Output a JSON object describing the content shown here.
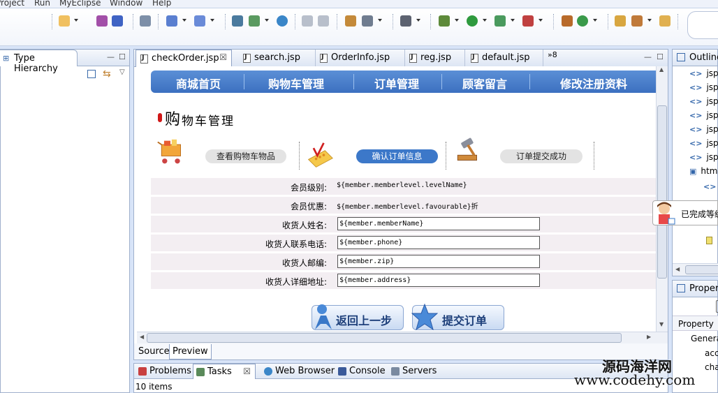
{
  "menu": [
    "Project",
    "Run",
    "MyEclipse",
    "Window",
    "Help"
  ],
  "left_view": {
    "title": "Type Hierarchy"
  },
  "editor": {
    "tabs": [
      {
        "label": "checkOrder.jsp",
        "active": true
      },
      {
        "label": "search.jsp"
      },
      {
        "label": "OrderInfo.jsp"
      },
      {
        "label": "reg.jsp"
      },
      {
        "label": "default.jsp"
      }
    ],
    "overflow_count": "»8",
    "mode_tabs": [
      "Source",
      "Preview"
    ]
  },
  "page": {
    "nav": [
      "商城首页",
      "购物车管理",
      "订单管理",
      "顾客留言",
      "修改注册资料"
    ],
    "section_title_big": "购",
    "section_title_rest": "物车管理",
    "steps": [
      {
        "label": "查看购物车物品",
        "active": false,
        "icon": "shopping-cart-icon"
      },
      {
        "label": "确认订单信息",
        "active": true,
        "icon": "calculator-icon"
      },
      {
        "label": "订单提交成功",
        "active": false,
        "icon": "gavel-icon"
      }
    ],
    "fields": [
      {
        "label": "会员级别:",
        "value": "${member.memberlevel.levelName}",
        "type": "text"
      },
      {
        "label": "会员优惠:",
        "value": "${member.memberlevel.favourable}折",
        "type": "text"
      },
      {
        "label": "收货人姓名:",
        "value": "${member.memberName}",
        "type": "input"
      },
      {
        "label": "收货人联系电话:",
        "value": "${member.phone}",
        "type": "input"
      },
      {
        "label": "收货人邮编:",
        "value": "${member.zip}",
        "type": "input"
      },
      {
        "label": "收货人详细地址:",
        "value": "${member.address}",
        "type": "input"
      }
    ],
    "buttons": {
      "back": "返回上一步",
      "submit": "提交订单"
    }
  },
  "bottom": {
    "tabs": [
      "Problems",
      "Tasks",
      "Web Browser",
      "Console",
      "Servers"
    ],
    "status": "10 items"
  },
  "outline": {
    "title": "Outline",
    "rows": [
      "jsp:",
      "jsp:",
      "jsp:",
      "jsp:",
      "jsp:",
      "jsp:",
      "jsp:",
      "htm"
    ]
  },
  "properties": {
    "title": "Proper",
    "column": "Property",
    "rows": [
      "Genera",
      "acc",
      "cha"
    ]
  },
  "notification": "已完成等级",
  "watermark": {
    "line1": "源码海洋网",
    "line2": "www.codehy.com"
  }
}
